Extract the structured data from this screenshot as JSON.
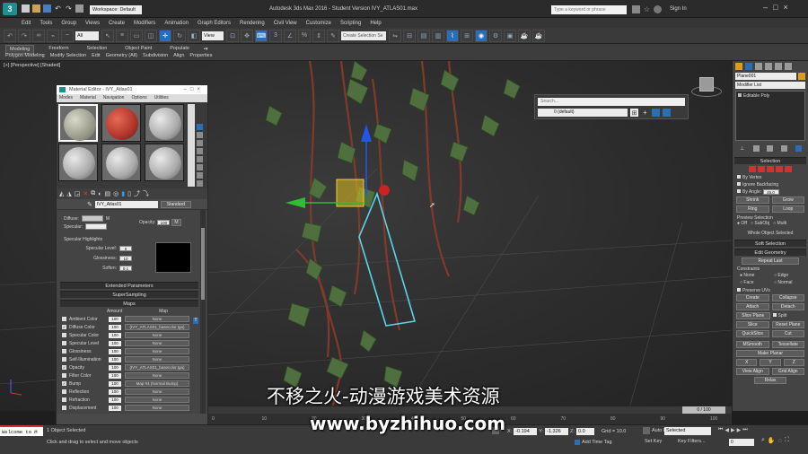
{
  "titlebar": {
    "workspace": "Workspace: Default",
    "title": "Autodesk 3ds Max 2016 - Student Version   IVY_ATLAS01.max",
    "search_placeholder": "Type a keyword or phrase",
    "sign_in": "Sign In"
  },
  "menu": [
    "Edit",
    "Tools",
    "Group",
    "Views",
    "Create",
    "Modifiers",
    "Animation",
    "Graph Editors",
    "Rendering",
    "Civil View",
    "Customize",
    "Scripting",
    "Help"
  ],
  "toolbar": {
    "filter": "All",
    "ref_coord": "View",
    "selection_set": "Create Selection Se"
  },
  "ribbon": {
    "tabs": [
      "Modeling",
      "Freeform",
      "Selection",
      "Object Paint",
      "Populate"
    ],
    "subtabs": [
      "Polygon Modeling",
      "Modify Selection",
      "Edit",
      "Geometry (All)",
      "Subdivision",
      "Align",
      "Properties"
    ]
  },
  "viewport": {
    "label": "[+] [Perspective] [Shaded]",
    "search_placeholder": "Search...",
    "layer": "0 (default)"
  },
  "material_editor": {
    "title": "Material Editor - IVY_Atlas01",
    "menu": [
      "Modes",
      "Material",
      "Navigation",
      "Options",
      "Utilities"
    ],
    "material_name": "IVY_Atlas01",
    "material_type": "Standard",
    "basic": {
      "diffuse": "Diffuse:",
      "specular": "Specular:",
      "m_label": "M",
      "opacity_label": "Opacity:",
      "opacity_value": "100",
      "m2": "M"
    },
    "spec_highlights": {
      "title": "Specular Highlights",
      "level_label": "Specular Level:",
      "level_value": "0",
      "gloss_label": "Glossiness:",
      "gloss_value": "10",
      "soften_label": "Soften:",
      "soften_value": "0.1"
    },
    "rollouts": [
      "Extended Parameters",
      "SuperSampling",
      "Maps"
    ],
    "maps_header": {
      "amount": "Amount",
      "map": "Map"
    },
    "maps": [
      {
        "label": "Ambient Color",
        "amount": "100",
        "map": "None",
        "checked": false
      },
      {
        "label": "Diffuse Color",
        "amount": "100",
        "map": "(IVY_ATLAS01_basecolor.tga)",
        "checked": true
      },
      {
        "label": "Specular Color",
        "amount": "100",
        "map": "None",
        "checked": false
      },
      {
        "label": "Specular Level",
        "amount": "100",
        "map": "None",
        "checked": false
      },
      {
        "label": "Glossiness",
        "amount": "100",
        "map": "None",
        "checked": false
      },
      {
        "label": "Self-Illumination",
        "amount": "100",
        "map": "None",
        "checked": false
      },
      {
        "label": "Opacity",
        "amount": "100",
        "map": "(IVY_ATLAS01_basecolor.tga)",
        "checked": true
      },
      {
        "label": "Filter Color",
        "amount": "100",
        "map": "None",
        "checked": false
      },
      {
        "label": "Bump",
        "amount": "100",
        "map": "Map #4 (Normal Bump)",
        "checked": true
      },
      {
        "label": "Reflection",
        "amount": "100",
        "map": "None",
        "checked": false
      },
      {
        "label": "Refraction",
        "amount": "100",
        "map": "None",
        "checked": false
      },
      {
        "label": "Displacement",
        "amount": "100",
        "map": "None",
        "checked": false
      }
    ],
    "lock_t": "T"
  },
  "command_panel": {
    "object_name": "Plane001",
    "modifier_list": "Modifier List",
    "stack_item": "Editable Poly",
    "selection": {
      "title": "Selection",
      "by_vertex": "By Vertex",
      "ignore_backfacing": "Ignore Backfacing",
      "by_angle": "By Angle:",
      "angle_value": "45.0",
      "shrink": "Shrink",
      "grow": "Grow",
      "ring": "Ring",
      "loop": "Loop",
      "preview_selection": "Preview Selection",
      "off": "Off",
      "subobj": "SubObj",
      "multi": "Multi",
      "whole_object": "Whole Object Selected"
    },
    "soft_selection": "Soft Selection",
    "edit_geometry": "Edit Geometry",
    "repeat_last": "Repeat Last",
    "constraints": {
      "title": "Constraints",
      "none": "None",
      "edge": "Edge",
      "face": "Face",
      "normal": "Normal"
    },
    "preserve_uvs": "Preserve UVs",
    "create": "Create",
    "collapse": "Collapse",
    "attach": "Attach",
    "detach": "Detach",
    "slice_plane": "Slice Plane",
    "split": "Split",
    "slice": "Slice",
    "reset_plane": "Reset Plane",
    "quickslice": "QuickSlice",
    "cut": "Cut",
    "msmooth": "MSmooth",
    "tessellate": "Tessellate",
    "make_planar": "Make Planar",
    "x": "X",
    "y": "Y",
    "z": "Z",
    "view_align": "View Align",
    "grid_align": "Grid Align",
    "relax": "Relax"
  },
  "timeline": {
    "frame": "0 / 100",
    "ticks": [
      "0",
      "10",
      "20",
      "30",
      "40",
      "50",
      "60",
      "70",
      "80",
      "90",
      "100"
    ]
  },
  "status": {
    "maxscript": "Welcome to M",
    "selected": "1 Object Selected",
    "prompt": "Click and drag to select and move objects",
    "x_label": "X:",
    "x_value": "-0.194",
    "y_label": "Y:",
    "y_value": "-1.326",
    "z_label": "Z:",
    "z_value": "0.0",
    "grid": "Grid = 10.0",
    "add_time_tag": "Add Time Tag",
    "auto_key": "Auto Key",
    "selected_dropdown": "Selected",
    "set_key": "Set Key",
    "key_filters": "Key Filters...",
    "frame_value": "0"
  },
  "watermark": {
    "chinese": "不移之火-动漫游戏美术资源",
    "url": "www.byzhihuo.com"
  }
}
